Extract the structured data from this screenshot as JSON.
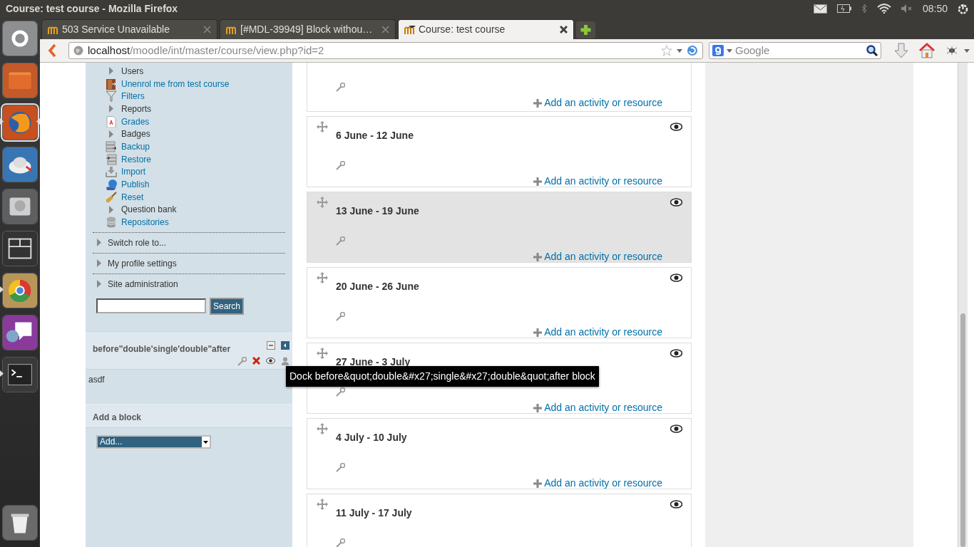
{
  "window": {
    "title": "Course: test course - Mozilla Firefox"
  },
  "system_tray": {
    "clock": "08:50"
  },
  "launcher": {
    "items": [
      {
        "running": false,
        "focused": false
      },
      {
        "running": false,
        "focused": false
      },
      {
        "running": true,
        "focused": true
      },
      {
        "running": false,
        "focused": false
      },
      {
        "running": false,
        "focused": false
      },
      {
        "running": false,
        "focused": false
      },
      {
        "running": true,
        "focused": false
      },
      {
        "running": false,
        "focused": false
      },
      {
        "running": true,
        "focused": false
      },
      {
        "running": false,
        "focused": false
      }
    ]
  },
  "browser": {
    "tabs": [
      {
        "title": "503 Service Unavailable",
        "selected": false
      },
      {
        "title": "[#MDL-39949] Block withou…",
        "selected": false
      },
      {
        "title": "Course: test course",
        "selected": true
      }
    ],
    "url": {
      "host": "localhost",
      "path": "/moodle/int/master/course/view.php?id=2"
    },
    "search": {
      "placeholder": "Google"
    }
  },
  "navigation": {
    "items": [
      {
        "label": "Users",
        "kind": "branch"
      },
      {
        "label": "Unenrol me from test course",
        "kind": "link"
      },
      {
        "label": "Filters",
        "kind": "link"
      },
      {
        "label": "Reports",
        "kind": "branch"
      },
      {
        "label": "Grades",
        "kind": "link"
      },
      {
        "label": "Badges",
        "kind": "branch"
      },
      {
        "label": "Backup",
        "kind": "link"
      },
      {
        "label": "Restore",
        "kind": "link"
      },
      {
        "label": "Import",
        "kind": "link"
      },
      {
        "label": "Publish",
        "kind": "link"
      },
      {
        "label": "Reset",
        "kind": "link"
      },
      {
        "label": "Question bank",
        "kind": "branch"
      },
      {
        "label": "Repositories",
        "kind": "link"
      }
    ],
    "sections": [
      {
        "label": "Switch role to..."
      },
      {
        "label": "My profile settings"
      },
      {
        "label": "Site administration"
      }
    ],
    "search_button": "Search"
  },
  "block": {
    "title": "before\"double'single'double\"after",
    "content": "asdf"
  },
  "add_block": {
    "title": "Add a block",
    "select": "Add..."
  },
  "course_sections": [
    {
      "add_link": "Add an activity or resource",
      "current": false
    },
    {
      "title": "6 June - 12 June",
      "add_link": "Add an activity or resource",
      "current": false
    },
    {
      "title": "13 June - 19 June",
      "add_link": "Add an activity or resource",
      "current": true
    },
    {
      "title": "20 June - 26 June",
      "add_link": "Add an activity or resource",
      "current": false
    },
    {
      "title": "27 June - 3 July",
      "add_link": "Add an activity or resource",
      "current": false
    },
    {
      "title": "4 July - 10 July",
      "add_link": "Add an activity or resource",
      "current": false
    },
    {
      "title": "11 July - 17 July",
      "current": false
    }
  ],
  "tooltip": "Dock before&quot;double&#x27;single&#x27;double&quot;after block"
}
